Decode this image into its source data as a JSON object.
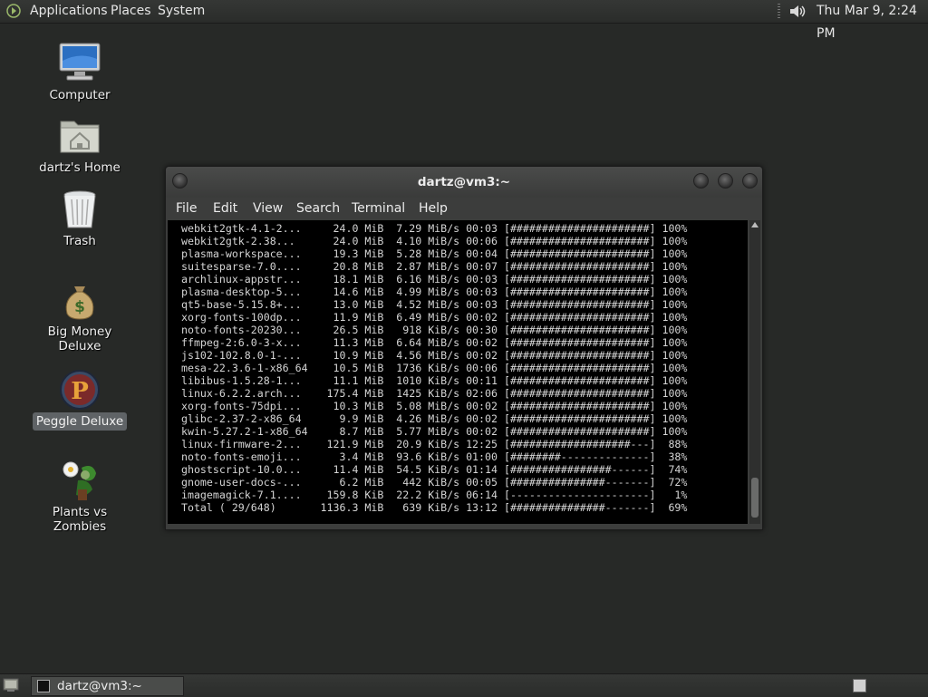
{
  "top_panel": {
    "menus": [
      "Applications",
      "Places",
      "System"
    ],
    "clock": "Thu Mar  9,  2:24 PM"
  },
  "desktop_icons": [
    {
      "label": "Computer"
    },
    {
      "label": "dartz's Home"
    },
    {
      "label": "Trash"
    },
    {
      "label": "Big Money Deluxe"
    },
    {
      "label": "Peggle Deluxe",
      "selected": true
    },
    {
      "label": "Plants vs Zombies"
    }
  ],
  "terminal": {
    "title": "dartz@vm3:~",
    "menu": [
      "File",
      "Edit",
      "View",
      "Search",
      "Terminal",
      "Help"
    ],
    "lines": [
      " webkit2gtk-4.1-2...     24.0 MiB  7.29 MiB/s 00:03 [######################] 100%",
      " webkit2gtk-2.38...      24.0 MiB  4.10 MiB/s 00:06 [######################] 100%",
      " plasma-workspace...     19.3 MiB  5.28 MiB/s 00:04 [######################] 100%",
      " suitesparse-7.0....     20.8 MiB  2.87 MiB/s 00:07 [######################] 100%",
      " archlinux-appstr...     18.1 MiB  6.16 MiB/s 00:03 [######################] 100%",
      " plasma-desktop-5...     14.6 MiB  4.99 MiB/s 00:03 [######################] 100%",
      " qt5-base-5.15.8+...     13.0 MiB  4.52 MiB/s 00:03 [######################] 100%",
      " xorg-fonts-100dp...     11.9 MiB  6.49 MiB/s 00:02 [######################] 100%",
      " noto-fonts-20230...     26.5 MiB   918 KiB/s 00:30 [######################] 100%",
      " ffmpeg-2:6.0-3-x...     11.3 MiB  6.64 MiB/s 00:02 [######################] 100%",
      " js102-102.8.0-1-...     10.9 MiB  4.56 MiB/s 00:02 [######################] 100%",
      " mesa-22.3.6-1-x86_64    10.5 MiB  1736 KiB/s 00:06 [######################] 100%",
      " libibus-1.5.28-1...     11.1 MiB  1010 KiB/s 00:11 [######################] 100%",
      " linux-6.2.2.arch...    175.4 MiB  1425 KiB/s 02:06 [######################] 100%",
      " xorg-fonts-75dpi...     10.3 MiB  5.08 MiB/s 00:02 [######################] 100%",
      " glibc-2.37-2-x86_64      9.9 MiB  4.26 MiB/s 00:02 [######################] 100%",
      " kwin-5.27.2-1-x86_64     8.7 MiB  5.77 MiB/s 00:02 [######################] 100%",
      " linux-firmware-2...    121.9 MiB  20.9 KiB/s 12:25 [###################---]  88%",
      " noto-fonts-emoji...      3.4 MiB  93.6 KiB/s 01:00 [########--------------]  38%",
      " ghostscript-10.0...     11.4 MiB  54.5 KiB/s 01:14 [################------]  74%",
      " gnome-user-docs-...      6.2 MiB   442 KiB/s 00:05 [###############-------]  72%",
      " imagemagick-7.1....    159.8 KiB  22.2 KiB/s 06:14 [----------------------]   1%",
      " Total ( 29/648)       1136.3 MiB   639 KiB/s 13:12 [###############-------]  69%"
    ]
  },
  "taskbar": {
    "tasks": [
      {
        "label": "dartz@vm3:~"
      }
    ]
  },
  "colors": {
    "desktop_bg": "#272927",
    "terminal_bg": "#000000",
    "terminal_fg": "#d4d4d4"
  }
}
